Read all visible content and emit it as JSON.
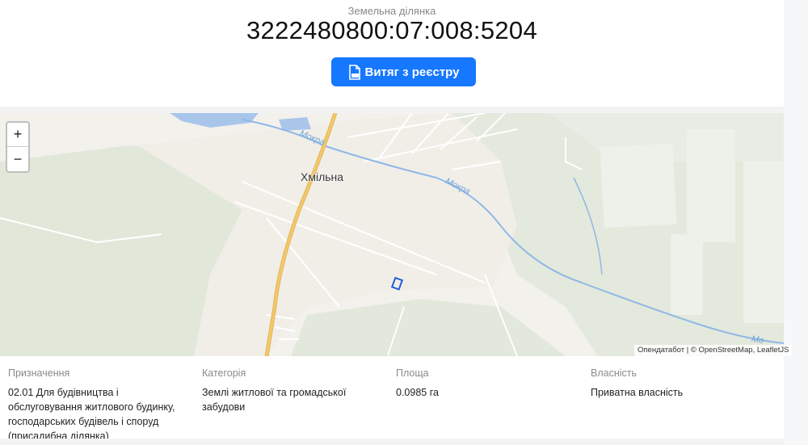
{
  "header": {
    "subtitle": "Земельна ділянка",
    "cadastral_number": "3222480800:07:008:5204",
    "extract_button_label": "Витяг з реєстру",
    "extract_button_icon": "pdf-file-icon"
  },
  "map": {
    "zoom_in_label": "+",
    "zoom_out_label": "−",
    "place_name": "Хмільна",
    "river_name_1": "Мокра",
    "river_name_2": "Мокра",
    "river_name_3": "Мо",
    "attribution_1": "Опендатабот",
    "attribution_sep": " | © ",
    "attribution_2": "OpenStreetMap",
    "attribution_3": ", LeafletJS",
    "colors": {
      "land": "#f3f1ec",
      "forest": "#dde6d7",
      "water": "#a9c6ea",
      "road_main": "#f4c769",
      "parcel": "#1f5fd6"
    }
  },
  "details": {
    "purpose_label": "Призначення",
    "purpose_value": "02.01 Для будівництва і обслуговування житлового будинку, господарських будівель і споруд (присадибна ділянка)",
    "category_label": "Категорія",
    "category_value": "Землі житлової та громадської забудови",
    "area_label": "Площа",
    "area_value": "0.0985 га",
    "ownership_label": "Власність",
    "ownership_value": "Приватна власність"
  },
  "theme": {
    "accent": "#1677ff"
  }
}
